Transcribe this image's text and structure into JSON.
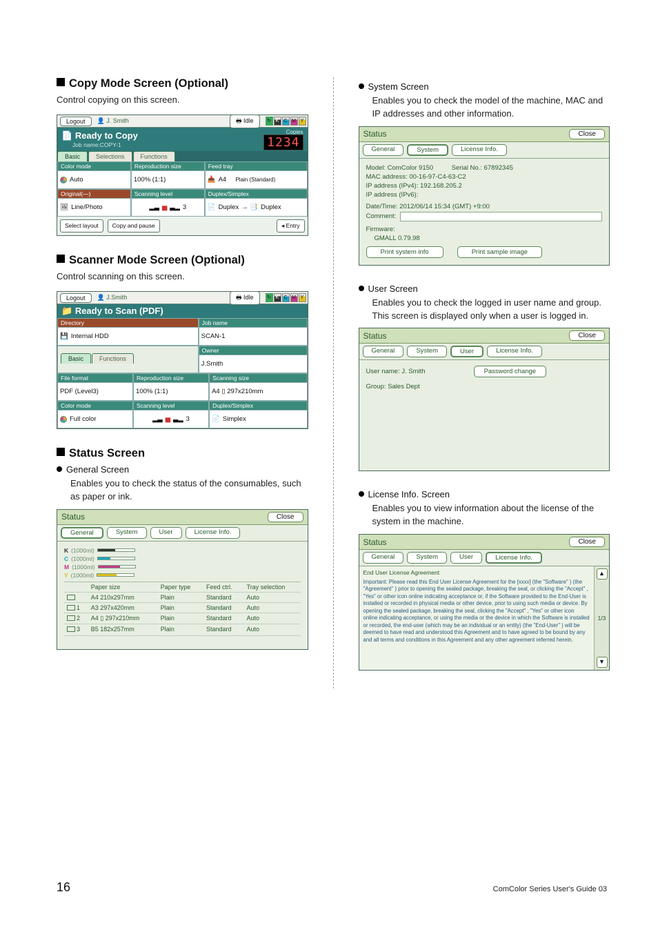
{
  "page_number": "16",
  "footer": "ComColor Series User's Guide 03",
  "left": {
    "copy": {
      "heading": "Copy Mode Screen (Optional)",
      "sub": "Control copying on this screen.",
      "logout": "Logout",
      "user": "J. Smith",
      "idle": "Idle",
      "ready": "Ready to Copy",
      "jobname": "Job name:COPY-1",
      "copies_lbl": "Copies",
      "copies_val": "1234",
      "tabs": {
        "basic": "Basic",
        "selections": "Selections",
        "functions": "Functions"
      },
      "cells": {
        "colormode": "Color mode",
        "colormode_v": "Auto",
        "repro": "Reproduction size",
        "repro_v": "100% (1:1)",
        "feed": "Feed tray",
        "feed_v": "A4",
        "feed_v2": "Plain (Standard)",
        "orig": "Original(—)",
        "orig_v": "Line/Photo",
        "scan": "Scanning level",
        "scan_v": "3",
        "dup": "Duplex/Simplex",
        "dup_v": "Duplex",
        "dup_v2": "Duplex"
      },
      "btn1": "Select layout",
      "btn2": "Copy and pause",
      "btn3": "◂ Entry"
    },
    "scanner": {
      "heading": "Scanner Mode Screen (Optional)",
      "sub": "Control scanning on this screen.",
      "logout": "Logout",
      "user": "J.Smith",
      "idle": "Idle",
      "ready": "Ready to Scan (PDF)",
      "dir": "Directory",
      "dir_v": "Internal HDD",
      "job": "Job name",
      "job_v": "SCAN-1",
      "owner": "Owner",
      "owner_v": "J.Smith",
      "tabs": {
        "basic": "Basic",
        "functions": "Functions"
      },
      "cells": {
        "ff": "File format",
        "ff_v": "PDF (Level3)",
        "repro": "Reproduction size",
        "repro_v": "100% (1:1)",
        "ssize": "Scanning size",
        "ssize_v": "A4 ▯ 297x210mm",
        "cm": "Color mode",
        "cm_v": "Full color",
        "sl": "Scanning level",
        "sl_v": "3",
        "dup": "Duplex/Simplex",
        "dup_v": "Simplex"
      }
    },
    "status": {
      "heading": "Status Screen",
      "gen_title": "General Screen",
      "gen_desc": "Enables you to check the status of the consumables, such as paper or ink.",
      "panel_title": "Status",
      "close": "Close",
      "tabs": {
        "general": "General",
        "system": "System",
        "user": "User",
        "license": "License Info."
      },
      "ink": [
        {
          "code": "K",
          "amt": "(1000ml)",
          "c": "#333",
          "w": "48%"
        },
        {
          "code": "C",
          "amt": "(1000ml)",
          "c": "#1aa6c4",
          "w": "35%"
        },
        {
          "code": "M",
          "amt": "(1000ml)",
          "c": "#c43a8a",
          "w": "60%"
        },
        {
          "code": "Y",
          "amt": "(1000ml)",
          "c": "#e0c022",
          "w": "52%"
        }
      ],
      "tbl_head": {
        "size": "Paper size",
        "type": "Paper type",
        "feed": "Feed ctrl.",
        "tray": "Tray selection"
      },
      "rows": [
        {
          "t": "",
          "s": "A4 210x297mm",
          "p": "Plain",
          "f": "Standard",
          "tr": "Auto"
        },
        {
          "t": "1",
          "s": "A3 297x420mm",
          "p": "Plain",
          "f": "Standard",
          "tr": "Auto"
        },
        {
          "t": "2",
          "s": "A4 ▯ 297x210mm",
          "p": "Plain",
          "f": "Standard",
          "tr": "Auto"
        },
        {
          "t": "3",
          "s": "B5 182x257mm",
          "p": "Plain",
          "f": "Standard",
          "tr": "Auto"
        }
      ]
    }
  },
  "right": {
    "system": {
      "title": "System Screen",
      "desc": "Enables you to check the model of the machine, MAC and IP addresses and other information.",
      "panel_title": "Status",
      "close": "Close",
      "tabs": {
        "general": "General",
        "system": "System",
        "license": "License Info."
      },
      "model_l": "Model:",
      "model_v": "ComColor 9150",
      "serial_l": "Serial No.:",
      "serial_v": "67892345",
      "mac": "MAC address: 00-16-97-C4-63-C2",
      "ip4": "IP address (IPv4): 192.168.205.2",
      "ip6": "IP address (IPv6):",
      "dt": "Date/Time: 2012/06/14 15:34 (GMT) +9:00",
      "comment": "Comment:",
      "fw": "Firmware:",
      "fw2": "GMALL   0.79.98",
      "btn1": "Print system info",
      "btn2": "Print sample image"
    },
    "user": {
      "title": "User Screen",
      "desc": "Enables you to check the logged in user name and group. This screen is displayed only when a user is logged in.",
      "panel_title": "Status",
      "close": "Close",
      "tabs": {
        "general": "General",
        "system": "System",
        "user": "User",
        "license": "License Info."
      },
      "un_l": "User name:",
      "un_v": "J. Smith",
      "pw": "Password change",
      "gr_l": "Group:",
      "gr_v": "Sales Dept"
    },
    "license": {
      "title": "License Info. Screen",
      "desc": "Enables you to view information about the license of the system in the machine.",
      "panel_title": "Status",
      "close": "Close",
      "tabs": {
        "general": "General",
        "system": "System",
        "user": "User",
        "license": "License Info."
      },
      "eula_title": "End User License Agreement",
      "eula_body": "Important: Please read this End User License Agreement for the [xxxx] (the \"Software\" ) (the \"Agreement\" ) prior to opening the sealed package, breaking the seal, or clicking the \"Accept\" , \"Yes\" or other icon online indicating acceptance or, if the Software provided to the End-User is installed or recorded in physical media or other device, prior to using such media or device. By opening the sealed package, breaking the seal, clicking the \"Accept\" , \"Yes\" or other icon online indicating acceptance, or using the media or the device in which the Software is installed or recorded, the end-user (which may be an individual or an entity) (the \"End-User\" ) will be deemed to have read and understood this Agreement and to have agreed to be bound by any and all terms and conditions in this Agreement and any other agreement referred herein.",
      "page": "1/3"
    }
  }
}
